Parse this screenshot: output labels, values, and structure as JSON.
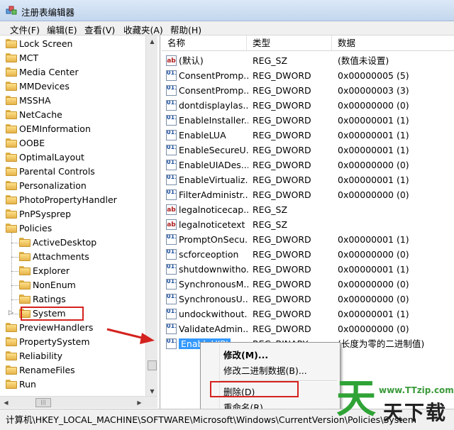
{
  "window": {
    "title": "注册表编辑器"
  },
  "menu": [
    "文件(F)",
    "编辑(E)",
    "查看(V)",
    "收藏夹(A)",
    "帮助(H)"
  ],
  "tree": [
    {
      "label": "Lock Screen",
      "level": 0
    },
    {
      "label": "MCT",
      "level": 0
    },
    {
      "label": "Media Center",
      "level": 0
    },
    {
      "label": "MMDevices",
      "level": 0
    },
    {
      "label": "MSSHA",
      "level": 0
    },
    {
      "label": "NetCache",
      "level": 0
    },
    {
      "label": "OEMInformation",
      "level": 0
    },
    {
      "label": "OOBE",
      "level": 0
    },
    {
      "label": "OptimalLayout",
      "level": 0
    },
    {
      "label": "Parental Controls",
      "level": 0
    },
    {
      "label": "Personalization",
      "level": 0
    },
    {
      "label": "PhotoPropertyHandler",
      "level": 0
    },
    {
      "label": "PnPSysprep",
      "level": 0
    },
    {
      "label": "Policies",
      "level": 0
    },
    {
      "label": "ActiveDesktop",
      "level": 1
    },
    {
      "label": "Attachments",
      "level": 1
    },
    {
      "label": "Explorer",
      "level": 1
    },
    {
      "label": "NonEnum",
      "level": 1
    },
    {
      "label": "Ratings",
      "level": 1
    },
    {
      "label": "System",
      "level": 1
    },
    {
      "label": "PreviewHandlers",
      "level": 0
    },
    {
      "label": "PropertySystem",
      "level": 0
    },
    {
      "label": "Reliability",
      "level": 0
    },
    {
      "label": "RenameFiles",
      "level": 0
    },
    {
      "label": "Run",
      "level": 0
    }
  ],
  "columns": {
    "name": "名称",
    "type": "类型",
    "data": "数据"
  },
  "values": [
    {
      "name": "(默认)",
      "type": "REG_SZ",
      "data": "(数值未设置)",
      "kind": "sz"
    },
    {
      "name": "ConsentPromp...",
      "type": "REG_DWORD",
      "data": "0x00000005 (5)",
      "kind": "bin"
    },
    {
      "name": "ConsentPromp...",
      "type": "REG_DWORD",
      "data": "0x00000003 (3)",
      "kind": "bin"
    },
    {
      "name": "dontdisplaylas...",
      "type": "REG_DWORD",
      "data": "0x00000000 (0)",
      "kind": "bin"
    },
    {
      "name": "EnableInstaller...",
      "type": "REG_DWORD",
      "data": "0x00000001 (1)",
      "kind": "bin"
    },
    {
      "name": "EnableLUA",
      "type": "REG_DWORD",
      "data": "0x00000001 (1)",
      "kind": "bin"
    },
    {
      "name": "EnableSecureU...",
      "type": "REG_DWORD",
      "data": "0x00000001 (1)",
      "kind": "bin"
    },
    {
      "name": "EnableUIADes...",
      "type": "REG_DWORD",
      "data": "0x00000000 (0)",
      "kind": "bin"
    },
    {
      "name": "EnableVirtualiz...",
      "type": "REG_DWORD",
      "data": "0x00000001 (1)",
      "kind": "bin"
    },
    {
      "name": "FilterAdministr...",
      "type": "REG_DWORD",
      "data": "0x00000000 (0)",
      "kind": "bin"
    },
    {
      "name": "legalnoticecap...",
      "type": "REG_SZ",
      "data": "",
      "kind": "sz"
    },
    {
      "name": "legalnoticetext",
      "type": "REG_SZ",
      "data": "",
      "kind": "sz"
    },
    {
      "name": "PromptOnSecu...",
      "type": "REG_DWORD",
      "data": "0x00000001 (1)",
      "kind": "bin"
    },
    {
      "name": "scforceoption",
      "type": "REG_DWORD",
      "data": "0x00000000 (0)",
      "kind": "bin"
    },
    {
      "name": "shutdownwitho...",
      "type": "REG_DWORD",
      "data": "0x00000001 (1)",
      "kind": "bin"
    },
    {
      "name": "SynchronousM...",
      "type": "REG_DWORD",
      "data": "0x00000000 (0)",
      "kind": "bin"
    },
    {
      "name": "SynchronousU...",
      "type": "REG_DWORD",
      "data": "0x00000000 (0)",
      "kind": "bin"
    },
    {
      "name": "undockwithout...",
      "type": "REG_DWORD",
      "data": "0x00000001 (1)",
      "kind": "bin"
    },
    {
      "name": "ValidateAdmin...",
      "type": "REG_DWORD",
      "data": "0x00000000 (0)",
      "kind": "bin"
    },
    {
      "name": "EnableUIPI",
      "type": "REG_BINARY",
      "data": "(长度为零的二进制值)",
      "kind": "bin",
      "selected": true
    }
  ],
  "context_menu": {
    "modify": "修改(M)...",
    "modify_binary": "修改二进制数据(B)...",
    "delete": "删除(D)",
    "rename": "重命名(R)"
  },
  "status": "计算机\\HKEY_LOCAL_MACHINE\\SOFTWARE\\Microsoft\\Windows\\CurrentVersion\\Policies\\System",
  "watermark": {
    "site": "www.TTzip.com",
    "big": "天",
    "sub": "天下载"
  },
  "colors": {
    "selection": "#3399ff",
    "highlight": "#d4221e",
    "watermark": "#2fa336"
  }
}
